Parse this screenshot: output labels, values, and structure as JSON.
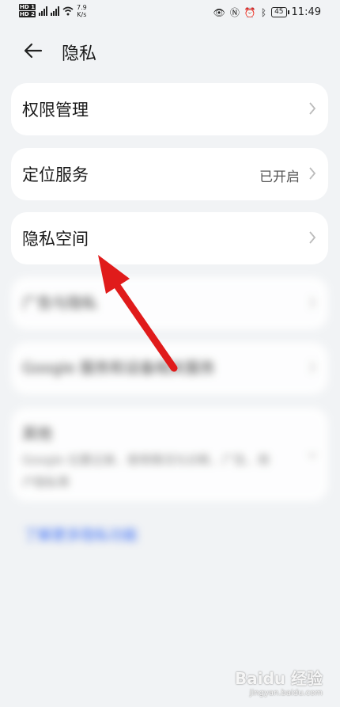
{
  "status_bar": {
    "speed_value": "7.9",
    "speed_unit": "K/s",
    "network": "4G",
    "battery": "45",
    "time": "11:49"
  },
  "header": {
    "title": "隐私"
  },
  "items": [
    {
      "label": "权限管理",
      "value": ""
    },
    {
      "label": "定位服务",
      "value": "已开启"
    },
    {
      "label": "隐私空间",
      "value": ""
    },
    {
      "label": "广告与隐私",
      "value": ""
    },
    {
      "label": "Google 服务和设备相关服务",
      "value": ""
    },
    {
      "label": "其他",
      "sub": "Google 位置记录、使用情况与诊断、广告、用户隐私等"
    }
  ],
  "link": "了解更多隐私功能",
  "watermark": {
    "brand": "Baidu 经验",
    "site": "jingyan.baidu.com"
  },
  "colors": {
    "background": "#f1f3f5",
    "card": "#ffffff",
    "arrow": "#e01b1b",
    "link": "#3b6ef5"
  }
}
